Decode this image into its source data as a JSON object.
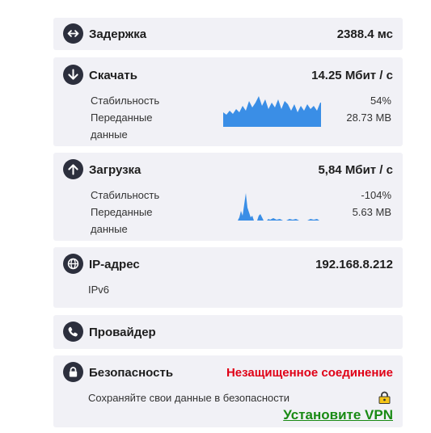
{
  "latency": {
    "label": "Задержка",
    "value": "2388.4 мс",
    "icon": "horizontal-arrows-icon"
  },
  "download": {
    "label": "Скачать",
    "value": "14.25 Мбит / с",
    "icon": "arrow-down-icon",
    "stability_label": "Стабильность",
    "stability_value": "54%",
    "transferred_label_1": "Переданные",
    "transferred_label_2": "данные",
    "transferred_value": "28.73 MB"
  },
  "upload": {
    "label": "Загрузка",
    "value": "5,84 Мбит / с",
    "icon": "arrow-up-icon",
    "stability_label": "Стабильность",
    "stability_value": "-104%",
    "transferred_label_1": "Переданные",
    "transferred_label_2": "данные",
    "transferred_value": "5.63 MB"
  },
  "ip": {
    "label": "IP-адрес",
    "value": "192.168.8.212",
    "version": "IPv6",
    "icon": "globe-icon"
  },
  "provider": {
    "label": "Провайдер",
    "icon": "phone-icon"
  },
  "security": {
    "label": "Безопасность",
    "value": "Незащищенное соединение",
    "hint": "Сохраняйте свои данные в безопасности",
    "vpn_link": "Установите VPN",
    "icon": "lock-icon"
  },
  "colors": {
    "card_bg": "#f1f1f6",
    "icon_bg": "#2c2f3d",
    "spark": "#3a8ee6",
    "danger": "#e00016",
    "vpn": "#198a14"
  }
}
